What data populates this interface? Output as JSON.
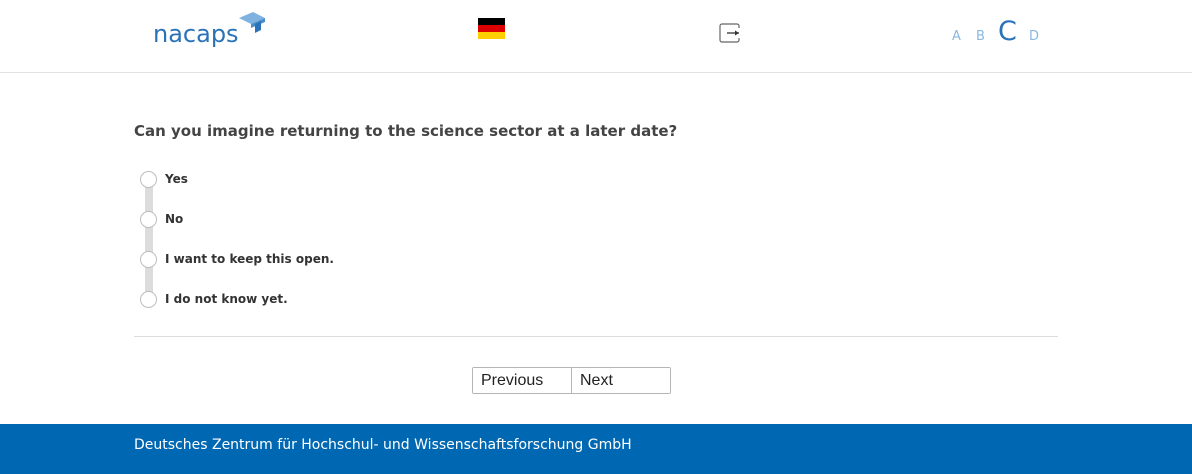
{
  "header": {
    "logo_text": "nacaps",
    "language_flag": "german-flag-icon",
    "logout_icon": "logout-icon",
    "font_sizes": [
      "A",
      "B",
      "C",
      "D"
    ],
    "active_font_size": "C"
  },
  "question": {
    "text": "Can you imagine returning to the science sector at a later date?",
    "options": [
      {
        "label": "Yes",
        "selected": false
      },
      {
        "label": "No",
        "selected": false
      },
      {
        "label": "I want to keep this open.",
        "selected": false
      },
      {
        "label": "I do not know yet.",
        "selected": false
      }
    ]
  },
  "navigation": {
    "previous_label": "Previous",
    "next_label": "Next"
  },
  "footer": {
    "text": "Deutsches Zentrum für Hochschul- und Wissenschaftsforschung GmbH"
  },
  "colors": {
    "brand_blue": "#0068b3",
    "logo_blue": "#2a73b8",
    "light_blue": "#8ab8e0"
  }
}
